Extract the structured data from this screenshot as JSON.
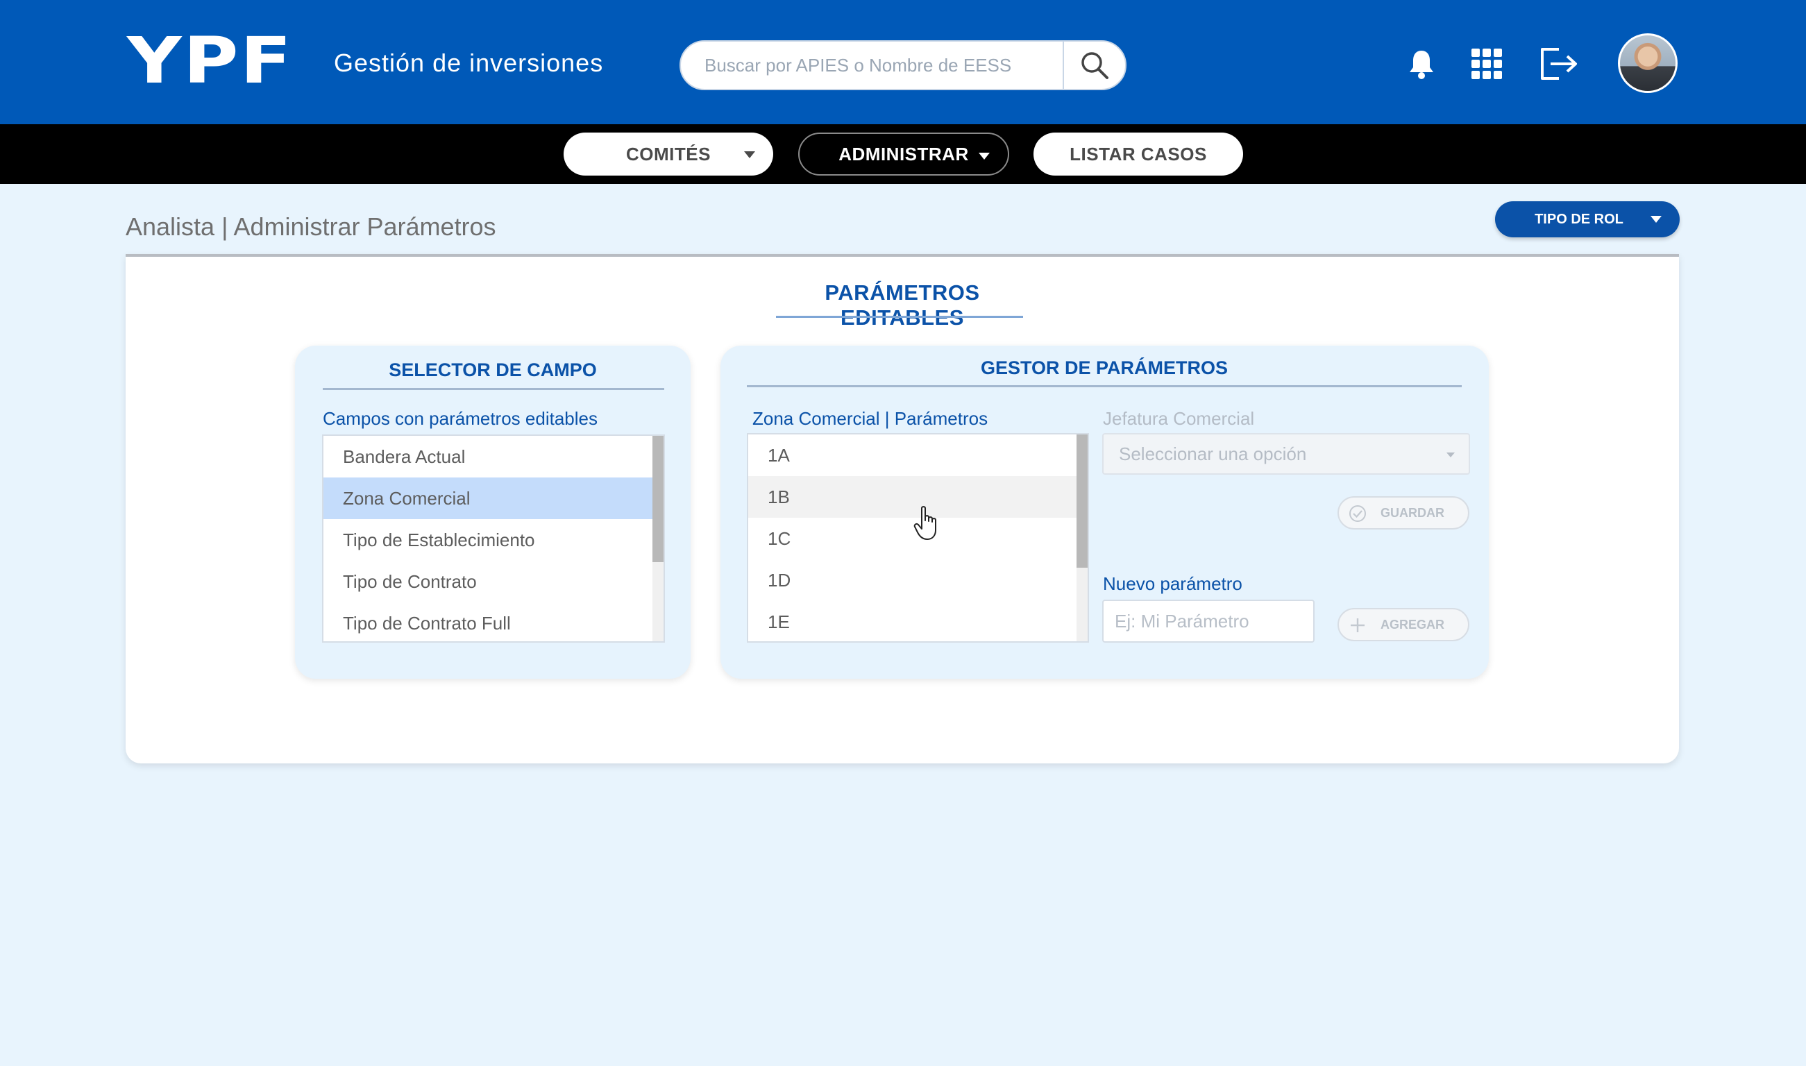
{
  "header": {
    "logo": "YPF",
    "app_title": "Gestión de inversiones",
    "search_placeholder": "Buscar por APIES o Nombre de EESS",
    "icons": [
      "search-icon",
      "bell-icon",
      "apps-grid-icon",
      "logout-icon",
      "avatar"
    ]
  },
  "nav": {
    "items": [
      {
        "label": "COMITÉS",
        "has_caret": true,
        "active": false
      },
      {
        "label": "ADMINISTRAR",
        "has_caret": true,
        "active": true
      },
      {
        "label": "LISTAR CASOS",
        "has_caret": false,
        "active": false
      }
    ]
  },
  "page": {
    "breadcrumb": "Analista | Administrar Parámetros",
    "role_button": "TIPO DE ROL",
    "section_title": "PARÁMETROS EDITABLES"
  },
  "selector": {
    "title": "SELECTOR DE CAMPO",
    "label": "Campos con parámetros editables",
    "items": [
      "Bandera Actual",
      "Zona Comercial",
      "Tipo de Establecimiento",
      "Tipo de Contrato",
      "Tipo de Contrato Full"
    ],
    "selected": "Zona Comercial"
  },
  "manager": {
    "title": "GESTOR DE PARÁMETROS",
    "list_label": "Zona Comercial | Parámetros",
    "params": [
      "1A",
      "1B",
      "1C",
      "1D",
      "1E"
    ],
    "hovered": "1B",
    "jefatura_label": "Jefatura Comercial",
    "jefatura_placeholder": "Seleccionar una opción",
    "save_label": "GUARDAR",
    "new_param_label": "Nuevo parámetro",
    "new_param_placeholder": "Ej: Mi Parámetro",
    "add_label": "AGREGAR"
  },
  "colors": {
    "brand_blue": "#0059b8",
    "accent_blue": "#0b52a8",
    "page_bg": "#e8f4fd",
    "selected_row": "#c4dcfb"
  }
}
